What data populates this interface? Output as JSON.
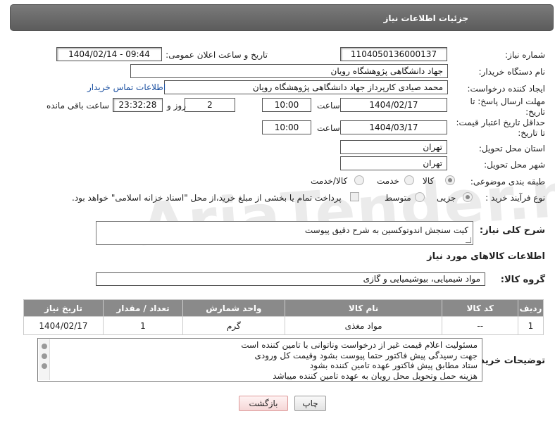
{
  "header": {
    "title": "جزئیات اطلاعات نیاز"
  },
  "watermark": {
    "text": "AriaTender.neT"
  },
  "form": {
    "need_number_label": "شماره نیاز:",
    "need_number": "1104050136000137",
    "announce_label": "تاریخ و ساعت اعلان عمومی:",
    "announce_value": "1404/02/14 - 09:44",
    "buyer_org_label": "نام دستگاه خریدار:",
    "buyer_org": "جهاد دانشگاهی پژوهشگاه رویان",
    "creator_label": "ایجاد کننده درخواست:",
    "creator": "محمد صیادی کارپرداز جهاد دانشگاهی پژوهشگاه رویان",
    "contact_link": "اطلاعات تماس خریدار",
    "deadline_label_1": "مهلت ارسال پاسخ: تا",
    "deadline_label_2": "تاریخ:",
    "deadline_date": "1404/02/17",
    "time_label": "ساعت",
    "deadline_time": "10:00",
    "days_value": "2",
    "days_label": "روز و",
    "remaining_time": "23:32:28",
    "remaining_label": "ساعت باقی مانده",
    "validity_label_1": "حداقل تاریخ اعتبار قیمت:",
    "validity_label_2": "تا تاریخ:",
    "validity_date": "1404/03/17",
    "validity_time": "10:00",
    "province_label": "استان محل تحویل:",
    "province": "تهران",
    "city_label": "شهر محل تحویل:",
    "city": "تهران",
    "category_label": "طبقه بندی موضوعی:",
    "category_options": [
      "کالا",
      "خدمت",
      "کالا/خدمت"
    ],
    "category_selected": "کالا",
    "process_label": "نوع فرآیند خرید :",
    "process_options": [
      "جزیی",
      "متوسط"
    ],
    "process_selected": "جزیی",
    "payment_note": "پرداخت تمام یا بخشی از مبلغ خرید،از محل \"اسناد خزانه اسلامی\" خواهد بود."
  },
  "need_description": {
    "label": "شرح کلی نیاز:",
    "value": "کیت سنجش اندوتوکسین به شرح دقیق پیوست"
  },
  "goods_info": {
    "title": "اطلاعات کالاهای مورد نیاز",
    "group_label": "گروه کالا:",
    "group_value": "مواد شیمیایی، بیوشیمیایی و  گازی"
  },
  "table": {
    "headers": [
      "ردیف",
      "کد کالا",
      "نام کالا",
      "واحد شمارش",
      "تعداد / مقدار",
      "تاریخ نیاز"
    ],
    "rows": [
      [
        "1",
        "--",
        "مواد مغذی",
        "گرم",
        "1",
        "1404/02/17"
      ]
    ]
  },
  "buyer_notes": {
    "label": "توضیحات خریدار:",
    "lines": [
      "مسئولیت اعلام قیمت  غیر از درخواست وناتوانی با تامین کننده است",
      "جهت رسیدگی پیش فاکتور حتما پیوست بشود وقیمت کل ورودی",
      "ستاد مطابق پیش فاکتور عهده تامین کننده بشود",
      "هزینه حمل وتحویل محل رویان به عهده تامین کننده میباشد"
    ]
  },
  "buttons": {
    "print": "چاپ",
    "back": "بازگشت"
  }
}
